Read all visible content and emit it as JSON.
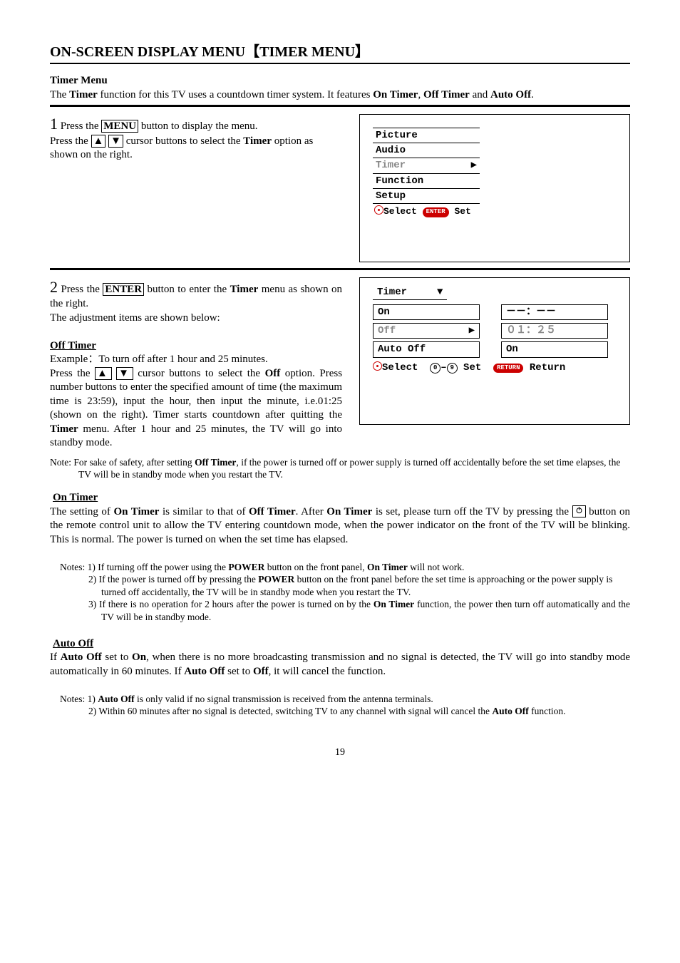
{
  "header": {
    "title_main": "ON-SCREEN DISPLAY MENU",
    "title_bracketed": "TIMER MENU"
  },
  "intro": {
    "sub": "Timer Menu",
    "line": "The Timer function for this TV uses a countdown timer system. It features On Timer, Off Timer and Auto Off."
  },
  "step1": {
    "num": "1",
    "s1": "Press the",
    "menu_btn": "MENU",
    "s2": "button to display the menu.",
    "line2a": "Press the",
    "up": "▲",
    "down": "▼",
    "line2b": "cursor buttons to select the",
    "timer_word": "Timer",
    "line2c": "option as shown on the right."
  },
  "osd1": {
    "picture": "Picture",
    "audio": "Audio",
    "timer": "Timer",
    "function": "Function",
    "setup": "Setup",
    "select_label": "Select",
    "enter_label": "ENTER",
    "set_label": "Set",
    "tri": "▶"
  },
  "step2": {
    "num": "2",
    "s1": "Press the",
    "enter_btn": "ENTER",
    "s2": "button to enter the",
    "timer_word": "Timer",
    "s3": "menu as shown on the right.",
    "line2": "The adjustment items are shown below:"
  },
  "osd2": {
    "hdr": "Timer",
    "down": "▼",
    "on": "On",
    "on_val": "－－：－－",
    "off": "Off",
    "off_val": "０１：２５",
    "autooff": "Auto Off",
    "autooff_val": "On",
    "select": "Select",
    "zero": "0",
    "nine": "9",
    "set": "Set",
    "return_badge": "RETURN",
    "return": "Return",
    "tri": "▶"
  },
  "offtimer": {
    "heading": "Off Timer",
    "example_lead": "Example：",
    "example_rest": "To turn off after 1 hour and 25 minutes.",
    "l1a": "Press the",
    "up": "▲",
    "down": "▼",
    "l1b": "cursor buttons to select the",
    "off_word": "Off",
    "l1c": "option. Press number buttons to enter the specified amount of time (the maximum time is 23:59), input the hour, then input the minute, i.e.01:25 (shown on the right). Timer starts countdown after quitting the",
    "timer_word": "Timer",
    "l1d": "menu. After 1 hour and 25 minutes, the TV will go into standby mode."
  },
  "note_off": "Note: For sake of safety, after setting Off Timer, if the power is turned off or power supply is turned off accidentally before the set time elapses, the TV will be in standby mode when you restart the TV.",
  "ontimer": {
    "heading": "On Timer",
    "body1": "The setting of On Timer is similar to that of Off Timer. After On Timer is set, please turn off the TV by pressing the ",
    "body2": " button on the remote control unit to allow the TV entering countdown mode, when the power indicator on the front of the TV will be blinking. This is normal. The power is turned on when the set time has elapsed."
  },
  "notes_on": {
    "lead": "Notes: 1) If turning off the power using the POWER button on the front panel, On Timer will not work.",
    "n2": "2) If the power is turned off by pressing the POWER button on the front panel before the set time is approaching or the power supply is turned off accidentally, the TV will be in standby mode when you restart the TV.",
    "n3": "3) If there is no operation for 2 hours after the power is turned on by the On Timer function, the power then turn off automatically and the TV will be in standby mode."
  },
  "autooff": {
    "heading": "Auto Off",
    "body": "If Auto Off set to On, when there is no more broadcasting transmission and no signal is detected, the TV will go into standby mode automatically in 60 minutes. If Auto Off set to Off, it will cancel the function."
  },
  "notes_auto": {
    "n1": "Notes: 1) Auto Off is only valid if no signal transmission is received from the antenna terminals.",
    "n2": "2) Within 60 minutes after no signal is detected, switching TV to any channel with signal will cancel the Auto Off function."
  },
  "pagenum": "19"
}
